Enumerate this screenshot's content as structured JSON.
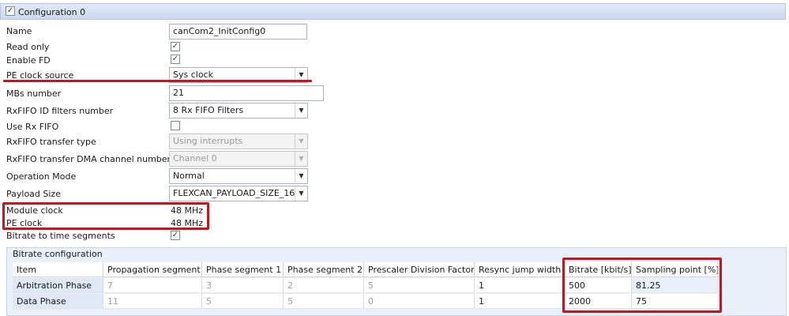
{
  "header": {
    "title": "Configuration 0",
    "checked": "✓"
  },
  "form": {
    "name_label": "Name",
    "name_value": "canCom2_InitConfig0",
    "readonly_label": "Read only",
    "readonly_check": "✓",
    "enablefd_label": "Enable FD",
    "enablefd_check": "✓",
    "peclksrc_label": "PE clock source",
    "peclksrc_value": "Sys clock",
    "mbs_label": "MBs number",
    "mbs_value": "21",
    "rxfifo_filters_label": "RxFIFO ID filters number",
    "rxfifo_filters_value": "8 Rx FIFO Filters",
    "userxfifo_label": "Use Rx FIFO",
    "rxfifo_transfer_label": "RxFIFO transfer type",
    "rxfifo_transfer_value": "Using interrupts",
    "dma_label": "RxFIFO transfer DMA channel number",
    "dma_value": "Channel 0",
    "opmode_label": "Operation Mode",
    "opmode_value": "Normal",
    "payload_label": "Payload Size",
    "payload_value": "FLEXCAN_PAYLOAD_SIZE_16",
    "modclk_label": "Module clock",
    "modclk_value": "48 MHz",
    "peclk_label": "PE clock",
    "peclk_value": "48 MHz",
    "bitrate_seg_label": "Bitrate to time segments",
    "bitrate_seg_check": "✓"
  },
  "bitrate": {
    "title": "Bitrate configuration",
    "columns": [
      "Item",
      "Propagation segment",
      "Phase segment 1",
      "Phase segment 2",
      "Prescaler Division Factor",
      "Resync jump width",
      "Bitrate [kbit/s]",
      "Sampling point [%]"
    ],
    "rows": [
      [
        "Arbitration Phase",
        "7",
        "3",
        "2",
        "5",
        "1",
        "500",
        "81.25"
      ],
      [
        "Data Phase",
        "11",
        "5",
        "5",
        "0",
        "1",
        "2000",
        "75"
      ]
    ]
  },
  "icons": {
    "combo_arrow": "▼"
  },
  "colors": {
    "highlight": "#c4161c",
    "header_bg": "#cbd9ef"
  }
}
